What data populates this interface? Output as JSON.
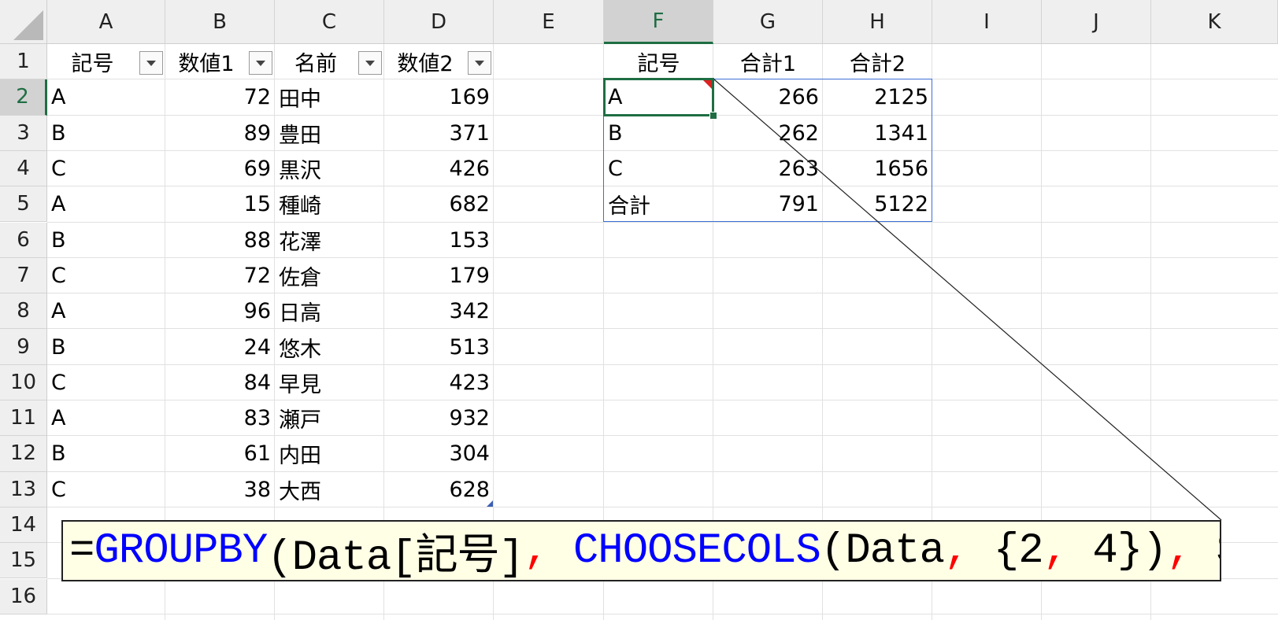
{
  "columns": [
    "A",
    "B",
    "C",
    "D",
    "E",
    "F",
    "G",
    "H",
    "I",
    "J",
    "K"
  ],
  "selected_column": "F",
  "selected_row": "2",
  "rows": [
    "1",
    "2",
    "3",
    "4",
    "5",
    "6",
    "7",
    "8",
    "9",
    "10",
    "11",
    "12",
    "13",
    "14",
    "15",
    "16"
  ],
  "table": {
    "headers": [
      "記号",
      "数値1",
      "名前",
      "数値2"
    ],
    "rows": [
      [
        "A",
        "72",
        "田中",
        "169"
      ],
      [
        "B",
        "89",
        "豊田",
        "371"
      ],
      [
        "C",
        "69",
        "黒沢",
        "426"
      ],
      [
        "A",
        "15",
        "種崎",
        "682"
      ],
      [
        "B",
        "88",
        "花澤",
        "153"
      ],
      [
        "C",
        "72",
        "佐倉",
        "179"
      ],
      [
        "A",
        "96",
        "日高",
        "342"
      ],
      [
        "B",
        "24",
        "悠木",
        "513"
      ],
      [
        "C",
        "84",
        "早見",
        "423"
      ],
      [
        "A",
        "83",
        "瀬戸",
        "932"
      ],
      [
        "B",
        "61",
        "内田",
        "304"
      ],
      [
        "C",
        "38",
        "大西",
        "628"
      ]
    ]
  },
  "result": {
    "headers": [
      "記号",
      "合計1",
      "合計2"
    ],
    "rows": [
      [
        "A",
        "266",
        "2125"
      ],
      [
        "B",
        "262",
        "1341"
      ],
      [
        "C",
        "263",
        "1656"
      ],
      [
        "合計",
        "791",
        "5122"
      ]
    ]
  },
  "formula": {
    "tokens": [
      {
        "text": "=",
        "color": "#000000"
      },
      {
        "text": "GROUPBY",
        "color": "#0000ff"
      },
      {
        "text": "(Data[記号]",
        "color": "#000000"
      },
      {
        "text": ",",
        "color": "#ff0000"
      },
      {
        "text": " ",
        "color": "#000000"
      },
      {
        "text": "CHOOSECOLS",
        "color": "#0000ff"
      },
      {
        "text": "(Data",
        "color": "#000000"
      },
      {
        "text": ",",
        "color": "#ff0000"
      },
      {
        "text": " {2",
        "color": "#000000"
      },
      {
        "text": ",",
        "color": "#ff0000"
      },
      {
        "text": " 4})",
        "color": "#000000"
      },
      {
        "text": ",",
        "color": "#ff0000"
      },
      {
        "text": " SUM)",
        "color": "#000000"
      }
    ]
  },
  "colors": {
    "selection_green": "#1f6e43",
    "spill_border_blue": "#3c6fd6",
    "comment_red": "#e02020",
    "callout_background": "#ffffe6"
  }
}
